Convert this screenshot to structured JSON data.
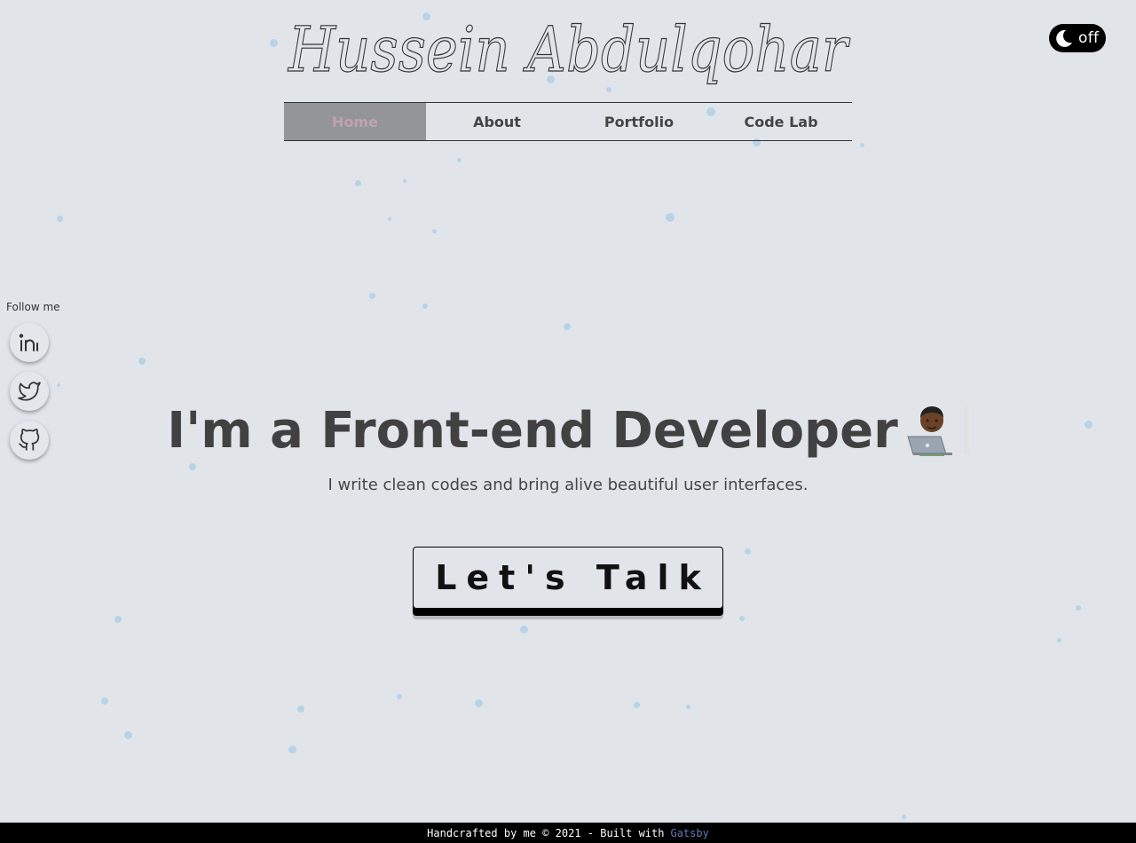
{
  "site": {
    "logo_text": "Hussein Abdulqohar"
  },
  "theme_toggle": {
    "label": "off",
    "icon": "moon-icon"
  },
  "nav": {
    "items": [
      {
        "label": "Home",
        "active": true
      },
      {
        "label": "About",
        "active": false
      },
      {
        "label": "Portfolio",
        "active": false
      },
      {
        "label": "Code Lab",
        "active": false
      }
    ]
  },
  "social": {
    "label": "Follow me",
    "links": [
      {
        "icon": "linkedin-icon"
      },
      {
        "icon": "twitter-icon"
      },
      {
        "icon": "github-icon"
      }
    ]
  },
  "hero": {
    "title": "I'm a Front-end Developer",
    "title_icon": "man-technologist-icon",
    "subtitle": "I write clean codes and bring alive beautiful user interfaces.",
    "cta_label": "Let's Talk"
  },
  "footer": {
    "text": "Handcrafted by me © 2021 - Built with",
    "link_label": "Gatsby"
  },
  "colors": {
    "background": "#e1e5ea",
    "active_nav_bg": "#939598",
    "active_nav_text": "#c0a2b1",
    "particles": "#b8d3e6",
    "footer_link": "#6675b8"
  }
}
